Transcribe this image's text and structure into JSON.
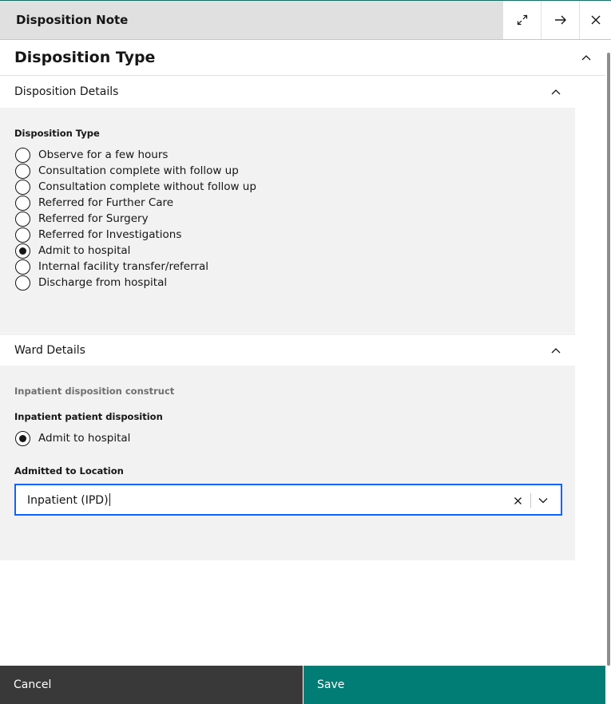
{
  "header": {
    "title": "Disposition Note",
    "actions": [
      {
        "icon": "maximize-icon"
      },
      {
        "icon": "arrow-right-icon"
      },
      {
        "icon": "close-icon"
      }
    ]
  },
  "section": {
    "title": "Disposition Type"
  },
  "disposition_details": {
    "label": "Disposition Details",
    "field_label": "Disposition Type",
    "options": [
      {
        "label": "Observe for a few hours",
        "checked": false
      },
      {
        "label": "Consultation complete with follow up",
        "checked": false
      },
      {
        "label": "Consultation complete without follow up",
        "checked": false
      },
      {
        "label": "Referred for Further Care",
        "checked": false
      },
      {
        "label": "Referred for Surgery",
        "checked": false
      },
      {
        "label": "Referred for Investigations",
        "checked": false
      },
      {
        "label": "Admit to hospital",
        "checked": true
      },
      {
        "label": "Internal facility transfer/referral",
        "checked": false
      },
      {
        "label": "Discharge from hospital",
        "checked": false
      }
    ]
  },
  "ward_details": {
    "label": "Ward Details",
    "construct_label": "Inpatient disposition construct",
    "inpatient_label": "Inpatient patient disposition",
    "inpatient_option": {
      "label": "Admit to hospital",
      "checked": true
    },
    "location_label": "Admitted to Location",
    "location_value": "Inpatient (IPD)"
  },
  "footer": {
    "cancel_label": "Cancel",
    "save_label": "Save"
  },
  "colors": {
    "accent": "#017d75",
    "focus": "#0f62fe",
    "cancel_bg": "#393939"
  }
}
